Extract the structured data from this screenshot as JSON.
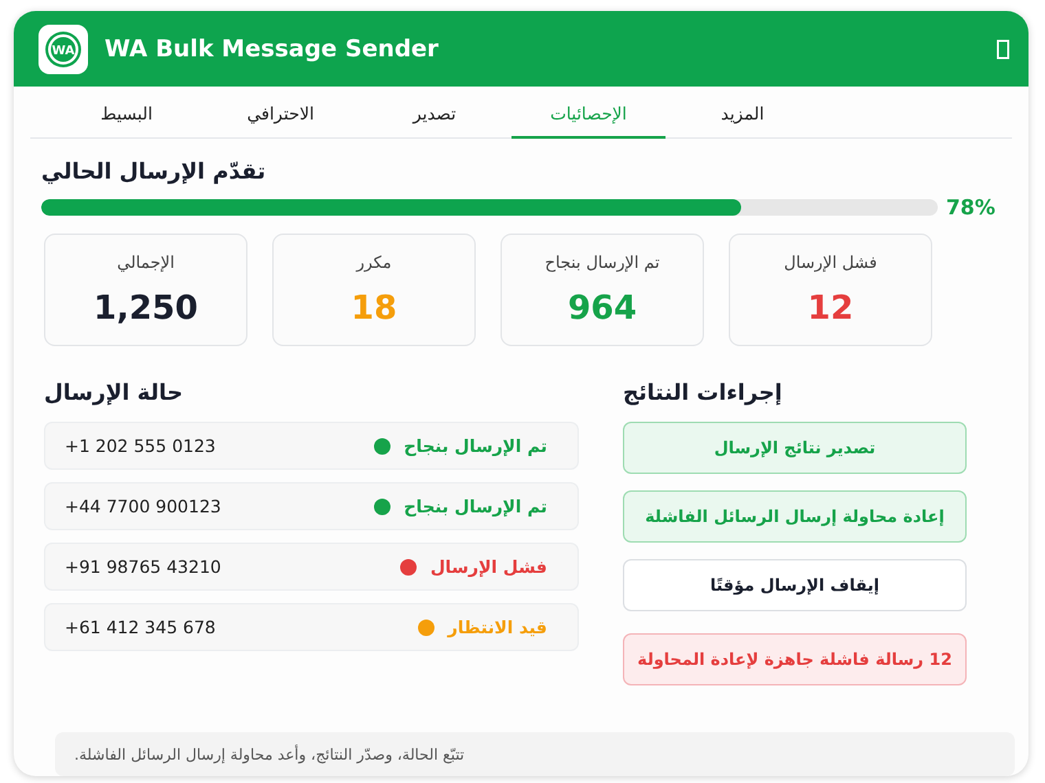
{
  "window": {
    "title": "WA Bulk Message Sender",
    "logo_text": "WA"
  },
  "tabs": [
    {
      "label": "المزيد",
      "selected": false
    },
    {
      "label": "الإحصائيات",
      "selected": true
    },
    {
      "label": "تصدير",
      "selected": false
    },
    {
      "label": "الاحترافي",
      "selected": false
    },
    {
      "label": "البسيط",
      "selected": false
    }
  ],
  "progress": {
    "title": "تقدّم الإرسال الحالي",
    "level": 0.78,
    "reading": "78%"
  },
  "stats": [
    {
      "label": "فشل الإرسال",
      "value": "12",
      "color": "#e53e3e"
    },
    {
      "label": "تم الإرسال بنجاح",
      "value": "964",
      "color": "#16a34a"
    },
    {
      "label": "مكرر",
      "value": "18",
      "color": "#f59e0b"
    },
    {
      "label": "الإجمالي",
      "value": "1,250",
      "color": "#1a1f2e"
    }
  ],
  "status_section": {
    "title": "حالة الإرسال",
    "rows": [
      {
        "phone": "+1 202 555 0123",
        "status": "تم الإرسال بنجاح",
        "color": "#16a34a"
      },
      {
        "phone": "+44 7700 900123",
        "status": "تم الإرسال بنجاح",
        "color": "#16a34a"
      },
      {
        "phone": "+91 98765 43210",
        "status": "فشل الإرسال",
        "color": "#e53e3e"
      },
      {
        "phone": "+61 412 345 678",
        "status": "قيد الانتظار",
        "color": "#f59e0b"
      }
    ]
  },
  "actions": {
    "title": "إجراءات النتائج",
    "buttons": [
      {
        "label": "تصدير نتائج الإرسال",
        "kind": "success"
      },
      {
        "label": "إعادة محاولة إرسال الرسائل الفاشلة",
        "kind": "success"
      },
      {
        "label": "إيقاف الإرسال مؤقتًا",
        "kind": "neutral"
      },
      {
        "label": "12 رسالة فاشلة جاهزة لإعادة المحاولة",
        "kind": "danger"
      }
    ]
  },
  "footer_note": "تتبّع الحالة، وصدّر النتائج، وأعد محاولة إرسال الرسائل الفاشلة."
}
